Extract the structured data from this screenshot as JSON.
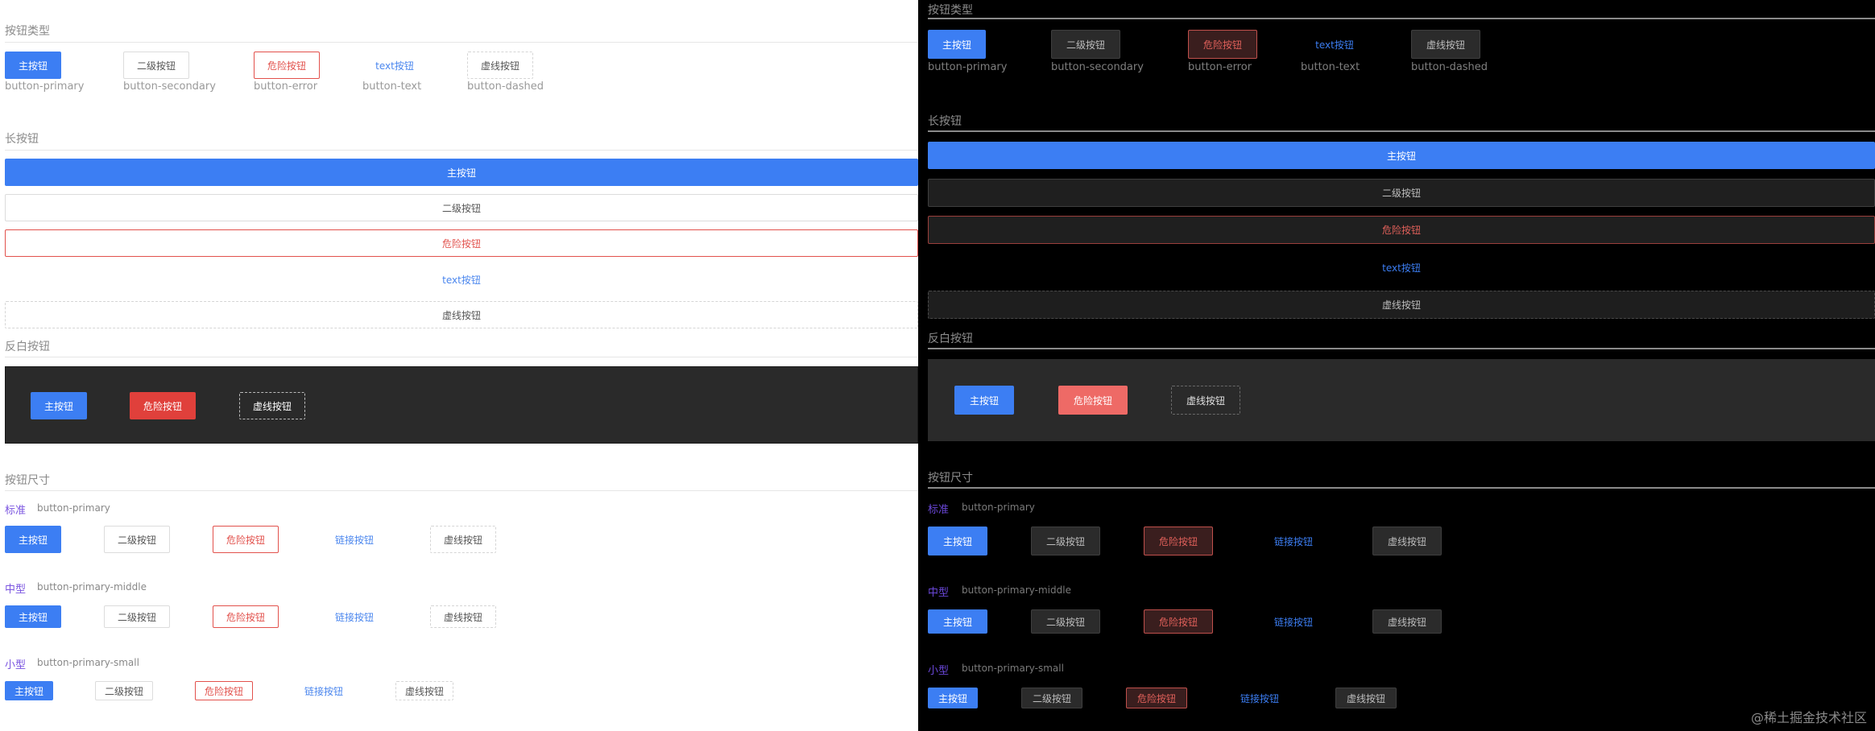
{
  "sections": {
    "types": "按钮类型",
    "long": "长按钮",
    "invert": "反白按钮",
    "sizes": "按钮尺寸"
  },
  "labels": {
    "primary": "主按钮",
    "secondary": "二级按钮",
    "error": "危险按钮",
    "text": "text按钮",
    "dashed": "虚线按钮",
    "link": "链接按钮"
  },
  "captions": {
    "primary": "button-primary",
    "secondary": "button-secondary",
    "error": "button-error",
    "text": "button-text",
    "dashed": "button-dashed"
  },
  "sizes": {
    "standard": {
      "label": "标准",
      "class": "button-primary"
    },
    "middle": {
      "label": "中型",
      "class": "button-primary-middle"
    },
    "small": {
      "label": "小型",
      "class": "button-primary-small"
    }
  },
  "watermark": "@稀土掘金技术社区",
  "colors": {
    "primary": "#3c7ef3",
    "error": "#e2514c",
    "size_label": "#7b55e0"
  }
}
